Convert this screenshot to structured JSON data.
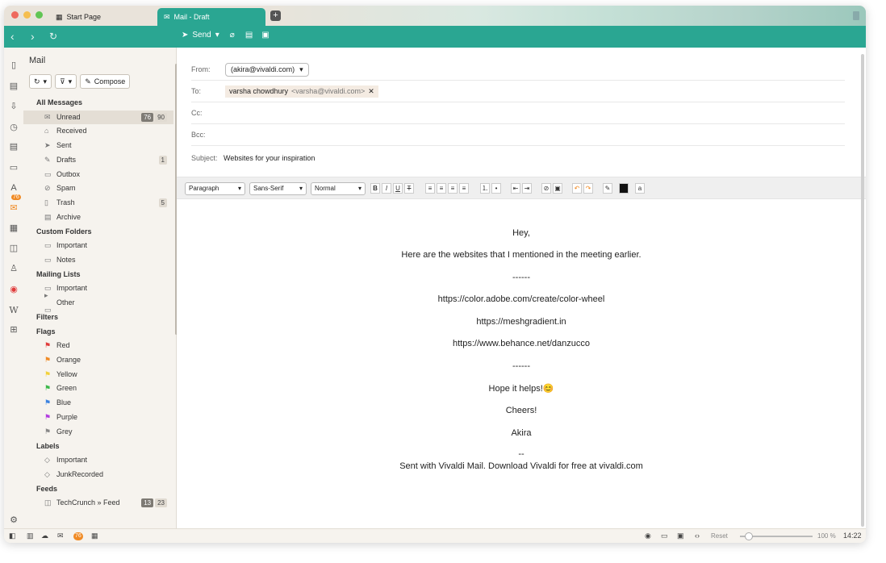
{
  "tabs": [
    {
      "label": "Start Page",
      "icon": "grid-icon"
    },
    {
      "label": "Mail - Draft",
      "icon": "envelope-icon"
    }
  ],
  "toolbar": {
    "send_label": "Send"
  },
  "panel": {
    "title": "Mail",
    "compose_label": "Compose",
    "sections": {
      "all_messages": "All Messages",
      "custom_folders": "Custom Folders",
      "mailing_lists": "Mailing Lists",
      "filters": "Filters",
      "flags": "Flags",
      "labels": "Labels",
      "feeds": "Feeds"
    },
    "folders": {
      "unread": {
        "label": "Unread",
        "count1": "76",
        "count2": "90"
      },
      "received": "Received",
      "sent": "Sent",
      "drafts": {
        "label": "Drafts",
        "count": "1"
      },
      "outbox": "Outbox",
      "spam": "Spam",
      "trash": {
        "label": "Trash",
        "count": "5"
      },
      "archive": "Archive"
    },
    "custom": [
      "Important",
      "Notes"
    ],
    "mailing": [
      "Important",
      "Other"
    ],
    "flags": [
      {
        "label": "Red",
        "color": "#e03b3b"
      },
      {
        "label": "Orange",
        "color": "#f08a24"
      },
      {
        "label": "Yellow",
        "color": "#f2d13b"
      },
      {
        "label": "Green",
        "color": "#3bb84a"
      },
      {
        "label": "Blue",
        "color": "#3b82e0"
      },
      {
        "label": "Purple",
        "color": "#b23be0"
      },
      {
        "label": "Grey",
        "color": "#888888"
      }
    ],
    "labels": [
      "Important",
      "JunkRecorded"
    ],
    "feed": {
      "label": "TechCrunch » Feed",
      "count1": "13",
      "count2": "23"
    }
  },
  "rail_badge": "76",
  "compose": {
    "from_label": "From:",
    "from_value": "(akira@vivaldi.com)",
    "to_label": "To:",
    "to_name": "varsha chowdhury",
    "to_addr": "<varsha@vivaldi.com>",
    "cc_label": "Cc:",
    "bcc_label": "Bcc:",
    "subject_label": "Subject:",
    "subject_value": "Websites for your inspiration"
  },
  "format": {
    "paragraph": "Paragraph",
    "font": "Sans-Serif",
    "size": "Normal"
  },
  "body": [
    "Hey,",
    "Here are the websites that I mentioned in the meeting earlier.",
    "------",
    "https://color.adobe.com/create/color-wheel",
    "https://meshgradient.in",
    "https://www.behance.net/danzucco",
    "------",
    "Hope it helps!😊",
    "Cheers!",
    "Akira",
    "--",
    "Sent with Vivaldi Mail. Download Vivaldi for free at vivaldi.com"
  ],
  "status": {
    "badge": "76",
    "reset": "Reset",
    "zoom": "100 %",
    "time": "14:22"
  }
}
